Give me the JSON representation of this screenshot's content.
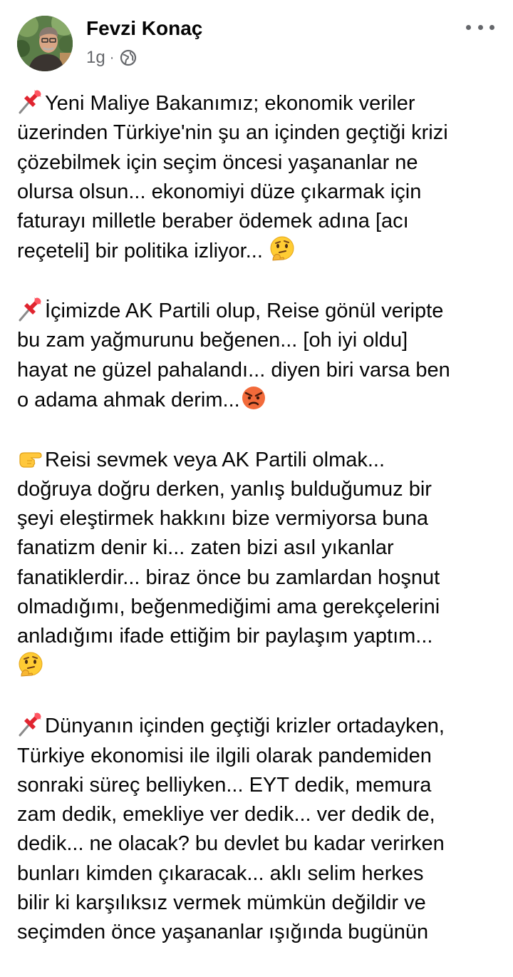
{
  "post": {
    "author_name": "Fevzi Konaç",
    "timestamp": "1g",
    "separator": "·",
    "privacy_icon": "globe-icon",
    "more_icon": "more-options-icon"
  },
  "paragraphs": [
    {
      "leading_icon": "pushpin-emoji",
      "lines": [
        "Yeni Maliye Bakanımız; ekonomik veriler",
        "üzerinden Türkiye'nin şu an içinden geçtiği krizi",
        "çözebilmek için seçim öncesi yaşananlar ne",
        "olursa olsun... ekonomiyi düze çıkarmak için",
        "faturayı milletle beraber ödemek adına [acı",
        "reçeteli] bir politika izliyor... "
      ],
      "trailing_icon": "thinking-face-emoji"
    },
    {
      "leading_icon": "pushpin-emoji",
      "lines": [
        "İçimizde AK Partili olup, Reise gönül veripte",
        "bu zam yağmurunu beğenen... [oh iyi oldu]",
        "hayat ne güzel pahalandı... diyen biri varsa ben",
        "o adama ahmak derim..."
      ],
      "trailing_icon": "angry-face-emoji"
    },
    {
      "leading_icon": "pointing-hand-emoji",
      "lines": [
        "Reisi sevmek veya AK Partili olmak...",
        "doğruya doğru derken, yanlış bulduğumuz bir",
        "şeyi eleştirmek hakkını bize vermiyorsa buna",
        "fanatizm denir ki... zaten bizi asıl yıkanlar",
        "fanatiklerdir... biraz önce bu zamlardan hoşnut",
        "olmadığımı, beğenmediğimi ama gerekçelerini",
        "anladığımı ifade ettiğim bir paylaşım yaptım...",
        ""
      ],
      "trailing_icon": "thinking-face-emoji"
    },
    {
      "leading_icon": "pushpin-emoji",
      "lines": [
        "Dünyanın içinden geçtiği krizler ortadayken,",
        "Türkiye ekonomisi ile ilgili olarak pandemiden",
        "sonraki süreç belliyken... EYT dedik, memura",
        "zam dedik, emekliye ver dedik... ver dedik de,",
        "dedik... ne olacak? bu devlet bu kadar verirken",
        "bunları kimden çıkaracak... aklı selim herkes",
        "bilir ki karşılıksız vermek mümkün değildir ve",
        "seçimden önce yaşananlar ışığında bugünün"
      ],
      "trailing_icon": ""
    }
  ]
}
